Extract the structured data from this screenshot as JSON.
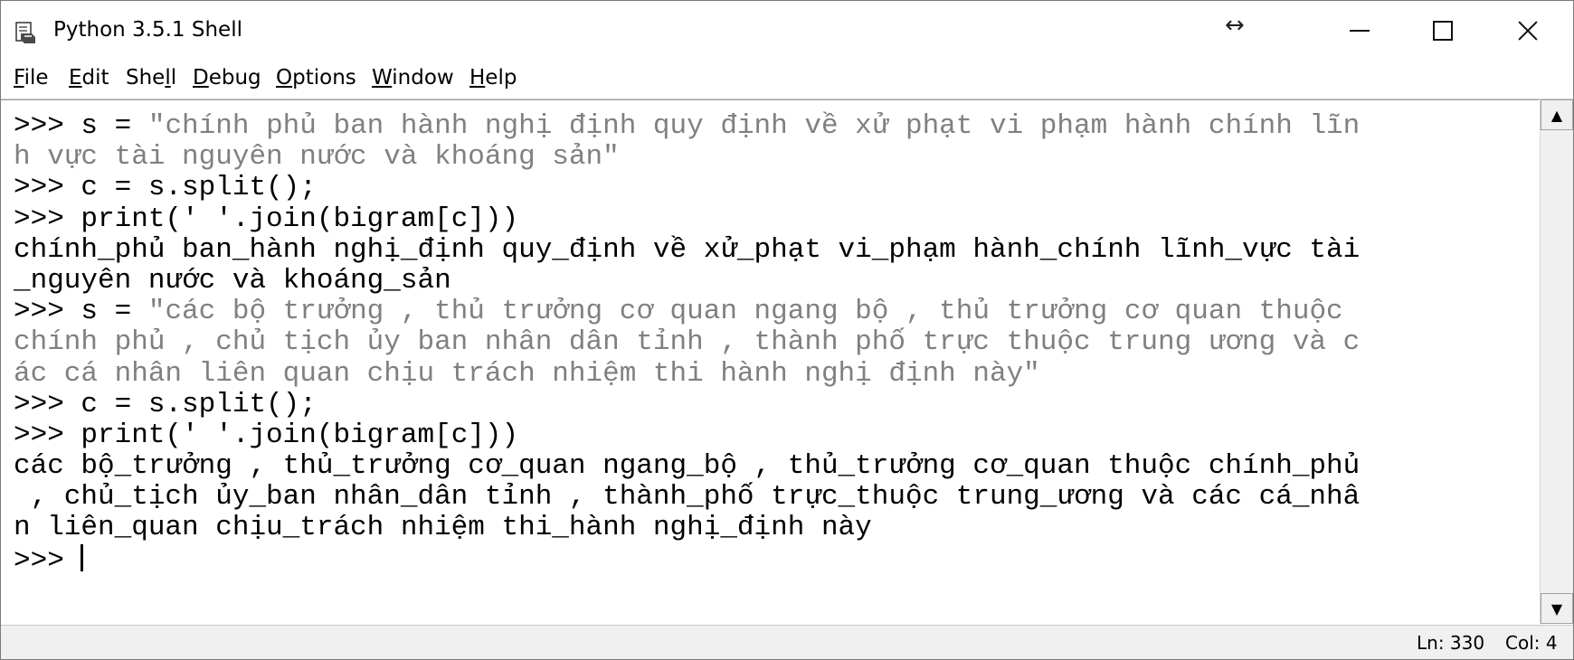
{
  "window": {
    "title": "Python 3.5.1 Shell"
  },
  "menu": [
    {
      "label": "File",
      "mnemonic": "F",
      "rest": "ile"
    },
    {
      "label": "Edit",
      "mnemonic": "E",
      "rest": "dit"
    },
    {
      "label": "Shell",
      "pre": "She",
      "mnemonic": "l",
      "rest": "l"
    },
    {
      "label": "Debug",
      "mnemonic": "D",
      "rest": "ebug"
    },
    {
      "label": "Options",
      "mnemonic": "O",
      "rest": "ptions"
    },
    {
      "label": "Window",
      "mnemonic": "W",
      "rest": "indow"
    },
    {
      "label": "Help",
      "mnemonic": "H",
      "rest": "elp"
    }
  ],
  "console": {
    "prompt": ">>> ",
    "lines": [
      {
        "prompt": ">>> ",
        "code": "s = ",
        "string": "\"chính phủ ban hành nghị định quy định về xử phạt vi phạm hành chính lĩn"
      },
      {
        "string": "h vực tài nguyên nước và khoáng sản\""
      },
      {
        "prompt": ">>> ",
        "code": "c = s.split();"
      },
      {
        "prompt": ">>> ",
        "code": "print(' '.join(bigram[c]))"
      },
      {
        "output": "chính_phủ ban_hành nghị_định quy_định về xử_phạt vi_phạm hành_chính lĩnh_vực tài"
      },
      {
        "output": "_nguyên nước và khoáng_sản"
      },
      {
        "prompt": ">>> ",
        "code": "s = ",
        "string": "\"các bộ trưởng , thủ trưởng cơ quan ngang bộ , thủ trưởng cơ quan thuộc"
      },
      {
        "string": "chính phủ , chủ tịch ủy ban nhân dân tỉnh , thành phố trực thuộc trung ương và c"
      },
      {
        "string": "ác cá nhân liên quan chịu trách nhiệm thi hành nghị định này\""
      },
      {
        "prompt": ">>> ",
        "code": "c = s.split();"
      },
      {
        "prompt": ">>> ",
        "code": "print(' '.join(bigram[c]))"
      },
      {
        "output": "các bộ_trưởng , thủ_trưởng cơ_quan ngang_bộ , thủ_trưởng cơ_quan thuộc chính_phủ"
      },
      {
        "output": " , chủ_tịch ủy_ban nhân_dân tỉnh , thành_phố trực_thuộc trung_ương và các cá_nhâ"
      },
      {
        "output": "n liên_quan chịu_trách nhiệm thi_hành nghị_định này"
      },
      {
        "prompt": ">>> ",
        "code": ""
      }
    ],
    "string_color": "#808080",
    "text_color": "#000000"
  },
  "status": {
    "line": "Ln: 330",
    "col": "Col: 4"
  },
  "icons": {
    "app": "python-idle-icon",
    "resize": "resize-horizontal-icon",
    "minimize": "minimize-icon",
    "maximize": "maximize-icon",
    "close": "close-icon",
    "scroll_up": "scroll-up-arrow-icon",
    "scroll_down": "scroll-down-arrow-icon"
  }
}
